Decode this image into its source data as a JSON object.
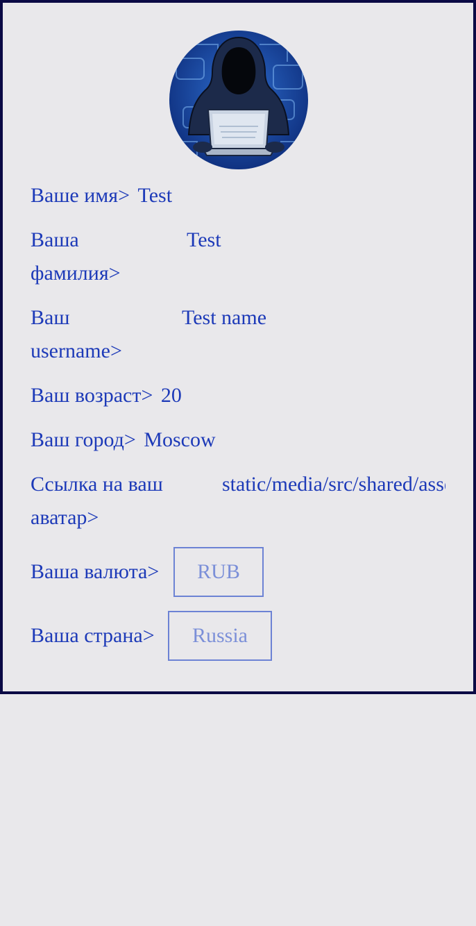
{
  "profile": {
    "name_label": "Ваше имя>",
    "name_value": "Test",
    "surname_label_1": "Ваша",
    "surname_label_2": "фамилия>",
    "surname_value": "Test",
    "username_label_1": "Ваш",
    "username_label_2": "username>",
    "username_value": "Test name",
    "age_label": "Ваш возраст>",
    "age_value": "20",
    "city_label": "Ваш город>",
    "city_value": "Moscow",
    "avatar_label_1": "Ссылка на ваш",
    "avatar_label_2": "аватар>",
    "avatar_value": "static/media/src/shared/assets/avatar.png",
    "currency_label": "Ваша валюта>",
    "currency_value": "RUB",
    "country_label": "Ваша страна>",
    "country_value": "Russia"
  },
  "icons": {
    "avatar": "hacker-avatar-icon"
  },
  "colors": {
    "text": "#1d3ab8",
    "border": "#0b0a45",
    "input_border": "#6c82d4",
    "input_text": "#7b8fd8",
    "background": "#e9e8eb"
  }
}
